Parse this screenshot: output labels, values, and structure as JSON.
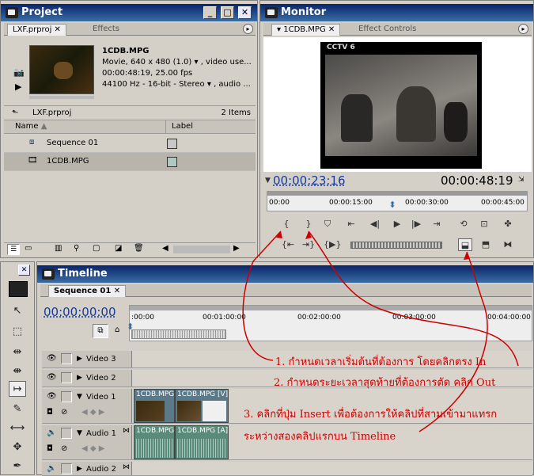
{
  "project": {
    "title": "Project",
    "tabs": [
      "LXF.prproj",
      "Effects"
    ],
    "clip_name": "1CDB.MPG",
    "clip_info1": "Movie, 640 x 480 (1.0)",
    "clip_info1_suffix": ", video use...",
    "clip_info2": "00:00:48:19, 25.00 fps",
    "clip_info3": "44100 Hz - 16-bit - Stereo",
    "clip_info3_suffix": ", audio ...",
    "bin_name": "LXF.prproj",
    "item_count": "2 Items",
    "col_name": "Name",
    "col_label": "Label",
    "items": [
      {
        "name": "Sequence 01",
        "color": "#c8c8c8"
      },
      {
        "name": "1CDB.MPG",
        "color": "#b0c8c0"
      }
    ]
  },
  "monitor": {
    "title": "Monitor",
    "tabs": [
      "1CDB.MPG",
      "Effect Controls"
    ],
    "current_time": "00:00:23:16",
    "duration": "00:00:48:19",
    "ruler": [
      "00:00",
      "00:00:15:00",
      "00:00:30:00",
      "00:00:45:00"
    ],
    "playhead_fraction": 0.48,
    "video_logo": "CCTV 6"
  },
  "timeline": {
    "title": "Timeline",
    "sequence_tab": "Sequence 01",
    "timecode": "00:00:00:00",
    "ruler": [
      ":00:00",
      "00:01:00:00",
      "00:02:00:00",
      "00:03:00:00",
      "00:04:00:00"
    ],
    "tracks": [
      {
        "name": "Video 3",
        "kind": "video"
      },
      {
        "name": "Video 2",
        "kind": "video"
      },
      {
        "name": "Video 1",
        "kind": "video"
      },
      {
        "name": "Audio 1",
        "kind": "audio"
      },
      {
        "name": "Audio 2",
        "kind": "audio"
      }
    ],
    "clips": {
      "v1a": "1CDB.MPG",
      "v1b": "1CDB.MPG [V]",
      "a1a": "1CDB.MPG",
      "a1b": "1CDB.MPG [A]"
    }
  },
  "annotations": {
    "step1": "1. กำหนดเวลาเริ่มต้นที่ต้องการ โดยคลิกตรง In",
    "step2": "2. กำหนดระยะเวลาสุดท้ายที่ต้องการตัด คลิก Out",
    "step3a": "3. คลิกที่ปุ่ม Insert เพื่อต้องการให้คลิปที่สามเข้ามาแทรก",
    "step3b": "ระหว่างสองคลิปแรกบน Timeline"
  },
  "colors": {
    "title_bar": "#0a246a",
    "timecode_blue": "#1a3a9a",
    "annotation_red": "#cc0000"
  }
}
